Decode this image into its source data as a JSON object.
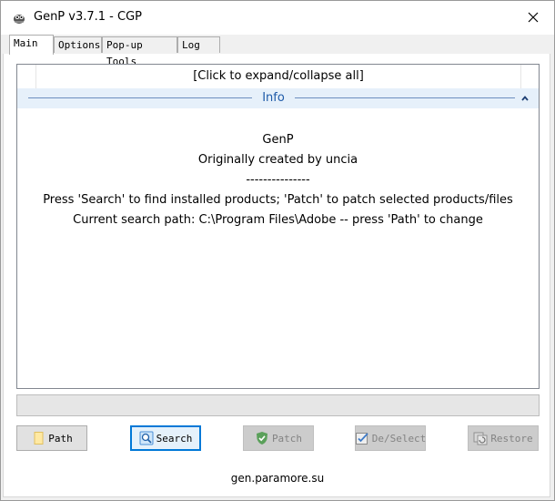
{
  "window": {
    "title": "GenP v3.7.1 - CGP",
    "close_symbol": "✕"
  },
  "tabs": [
    {
      "label": "Main",
      "active": true
    },
    {
      "label": "Options",
      "active": false
    },
    {
      "label": "Pop-up Tools",
      "active": false
    },
    {
      "label": "Log",
      "active": false
    }
  ],
  "list": {
    "header": "[Click to expand/collapse all]",
    "group": {
      "label": "Info",
      "collapse_icon": "chevron-up-icon",
      "lines": [
        "GenP",
        "Originally created by uncia",
        "---------------",
        "Press 'Search' to find installed products; 'Patch' to patch selected products/files",
        "Current search path: C:\\Program Files\\Adobe -- press 'Path' to change"
      ]
    }
  },
  "progress": {
    "value": 0
  },
  "buttons": [
    {
      "label": "Path",
      "icon": "folder-icon",
      "enabled": true,
      "default": false
    },
    {
      "label": "Search",
      "icon": "magnifier-icon",
      "enabled": true,
      "default": true
    },
    {
      "label": "Patch",
      "icon": "shield-check-icon",
      "enabled": false,
      "default": false
    },
    {
      "label": "De/Select",
      "icon": "checkbox-icon",
      "enabled": false,
      "default": false
    },
    {
      "label": "Restore",
      "icon": "restore-icon",
      "enabled": false,
      "default": false
    }
  ],
  "footer": {
    "link": "gen.paramore.su"
  },
  "colors": {
    "accent": "#0078d7",
    "group_header_bg": "#e6f0fa",
    "group_text": "#1e5aa8"
  }
}
